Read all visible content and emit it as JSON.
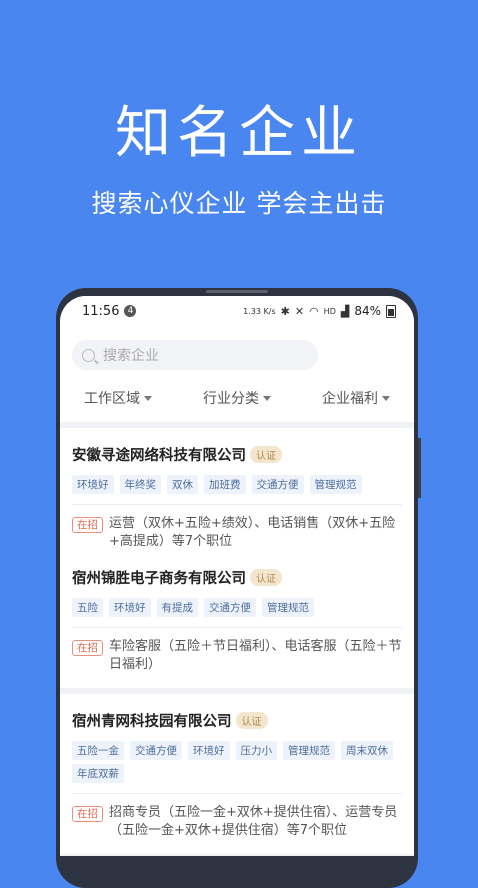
{
  "hero": {
    "title": "知名企业",
    "subtitle": "搜索心仪企业  学会主出击"
  },
  "status_bar": {
    "time": "11:56",
    "notif_count": "4",
    "battery": "84%",
    "net_speed": "1.33 K/s",
    "network": "HD"
  },
  "search": {
    "placeholder": "搜索企业"
  },
  "filters": [
    {
      "label": "工作区域"
    },
    {
      "label": "行业分类"
    },
    {
      "label": "企业福利"
    }
  ],
  "companies": [
    {
      "name": "安徽寻途网络科技有限公司",
      "badge": "认证",
      "tags": [
        "环境好",
        "年终奖",
        "双休",
        "加班费",
        "交通方便",
        "管理规范"
      ],
      "hiring_label": "在招",
      "jobs": "运营（双休+五险+绩效）、电话销售（双休+五险+高提成）等7个职位"
    },
    {
      "name": "宿州锦胜电子商务有限公司",
      "badge": "认证",
      "tags": [
        "五险",
        "环境好",
        "有提成",
        "交通方便",
        "管理规范"
      ],
      "hiring_label": "在招",
      "jobs": "车险客服（五险＋节日福利）、电话客服（五险＋节日福利）"
    },
    {
      "name": "宿州青网科技园有限公司",
      "badge": "认证",
      "tags": [
        "五险一金",
        "交通方便",
        "环境好",
        "压力小",
        "管理规范",
        "周末双休",
        "年底双薪"
      ],
      "hiring_label": "在招",
      "jobs": "招商专员（五险一金+双休+提供住宿）、运营专员（五险一金+双休+提供住宿）等7个职位"
    }
  ]
}
